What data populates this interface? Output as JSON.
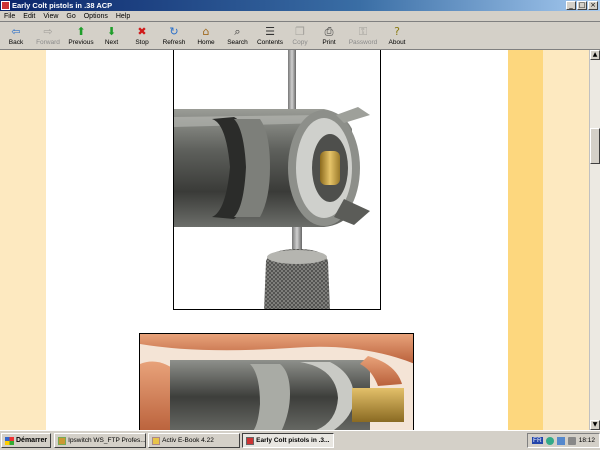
{
  "window": {
    "title": "Early Colt pistols in .38 ACP",
    "controls": [
      "_",
      "□",
      "×"
    ]
  },
  "menu": [
    "File",
    "Edit",
    "View",
    "Go",
    "Options",
    "Help"
  ],
  "toolbar": [
    {
      "label": "Back",
      "icon": "back-arrow-icon",
      "glyph": "⇦",
      "color": "#2a6fc9",
      "enabled": true
    },
    {
      "label": "Forward",
      "icon": "forward-arrow-icon",
      "glyph": "⇨",
      "color": "#555555",
      "enabled": false
    },
    {
      "label": "Previous",
      "icon": "up-arrow-icon",
      "glyph": "⬆",
      "color": "#1e9e2a",
      "enabled": true
    },
    {
      "label": "Next",
      "icon": "down-arrow-icon",
      "glyph": "⬇",
      "color": "#1e9e2a",
      "enabled": true
    },
    {
      "label": "Stop",
      "icon": "stop-icon",
      "glyph": "✖",
      "color": "#d01818",
      "enabled": true
    },
    {
      "label": "Refresh",
      "icon": "refresh-icon",
      "glyph": "↻",
      "color": "#2a6fc9",
      "enabled": true
    },
    {
      "label": "Home",
      "icon": "home-icon",
      "glyph": "⌂",
      "color": "#a06a20",
      "enabled": true
    },
    {
      "label": "Search",
      "icon": "search-icon",
      "glyph": "⌕",
      "color": "#333333",
      "enabled": true
    },
    {
      "label": "Contents",
      "icon": "contents-icon",
      "glyph": "☰",
      "color": "#333333",
      "enabled": true
    },
    {
      "label": "Copy",
      "icon": "copy-icon",
      "glyph": "❐",
      "color": "#555555",
      "enabled": false
    },
    {
      "label": "Print",
      "icon": "print-icon",
      "glyph": "⎙",
      "color": "#333333",
      "enabled": true
    },
    {
      "label": "Password",
      "icon": "key-icon",
      "glyph": "⚿",
      "color": "#555555",
      "enabled": false
    },
    {
      "label": "About",
      "icon": "help-icon",
      "glyph": "?",
      "color": "#8a7a10",
      "enabled": true
    }
  ],
  "taskbar": {
    "start_label": "Démarrer",
    "tasks": [
      {
        "label": "Ipswitch WS_FTP Profes...",
        "active": false
      },
      {
        "label": "Activ E-Book 4.22",
        "active": false
      },
      {
        "label": "Early Colt pistols in .3...",
        "active": true
      }
    ],
    "tray_lang": "FR",
    "clock": "18:12"
  },
  "colors": {
    "band_light": "#fde9c0",
    "band_dark": "#fdd77e",
    "titlebar": "#0a246a"
  }
}
